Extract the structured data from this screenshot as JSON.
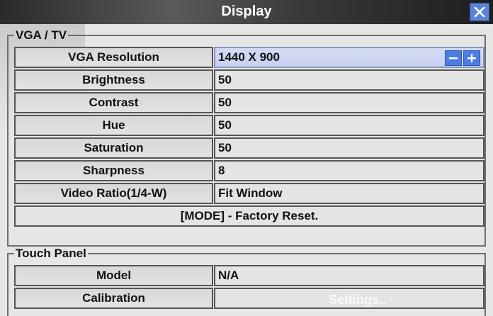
{
  "window": {
    "title": "Display",
    "close_icon": "close-icon"
  },
  "vga_group": {
    "legend": "VGA / TV",
    "rows": [
      {
        "label": "VGA Resolution",
        "value": "1440 X 900"
      },
      {
        "label": "Brightness",
        "value": "50"
      },
      {
        "label": "Contrast",
        "value": "50"
      },
      {
        "label": "Hue",
        "value": "50"
      },
      {
        "label": "Saturation",
        "value": "50"
      },
      {
        "label": "Sharpness",
        "value": "8"
      },
      {
        "label": "Video Ratio(1/4-W)",
        "value": "Fit Window"
      }
    ],
    "factory_reset": "[MODE] - Factory Reset."
  },
  "touch_group": {
    "legend": "Touch Panel",
    "rows": [
      {
        "label": "Model",
        "value": "N/A"
      },
      {
        "label": "Calibration",
        "value": "Settings.."
      }
    ]
  },
  "colors": {
    "accent": "#4c7de0",
    "active_field": "#c7d0f0"
  }
}
